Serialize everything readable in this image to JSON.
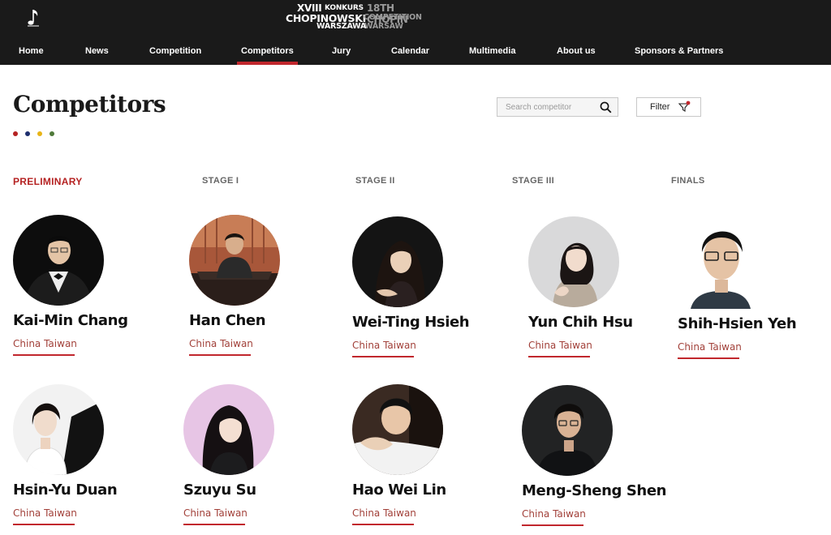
{
  "brand": {
    "line1_roman": "XVIII",
    "line1_konkurs": "KONKURS",
    "line1_ordinal": "18TH CHOPIN",
    "line2_name": "CHOPINOWSKI",
    "line2_competition": "COMPETITION",
    "line3_city": "WARSZAWA",
    "line3_city_en": "WARSAW",
    "icon": "piano-note-icon"
  },
  "nav": {
    "items": [
      {
        "label": "Home"
      },
      {
        "label": "News"
      },
      {
        "label": "Competition"
      },
      {
        "label": "Competitors"
      },
      {
        "label": "Jury"
      },
      {
        "label": "Calendar"
      },
      {
        "label": "Multimedia"
      },
      {
        "label": "About us"
      },
      {
        "label": "Sponsors & Partners"
      }
    ],
    "active": "Competitors"
  },
  "page": {
    "title": "Competitors",
    "dot_colors": [
      "#b52222",
      "#1e2f6e",
      "#e8b417",
      "#4f7a3a"
    ]
  },
  "search": {
    "placeholder": "Search competitor",
    "icon": "search-icon"
  },
  "filter": {
    "label": "Filter",
    "icon": "filter-icon"
  },
  "stages": [
    {
      "label": "PRELIMINARY",
      "active": true
    },
    {
      "label": "STAGE I"
    },
    {
      "label": "STAGE II"
    },
    {
      "label": "STAGE III"
    },
    {
      "label": "FINALS"
    }
  ],
  "competitors": [
    {
      "name": "Kai-Min Chang",
      "country": "China Taiwan"
    },
    {
      "name": "Han Chen",
      "country": "China Taiwan"
    },
    {
      "name": "Wei-Ting Hsieh",
      "country": "China Taiwan"
    },
    {
      "name": "Yun Chih Hsu",
      "country": "China Taiwan"
    },
    {
      "name": "Shih-Hsien Yeh",
      "country": "China Taiwan"
    },
    {
      "name": "Hsin-Yu Duan",
      "country": "China Taiwan"
    },
    {
      "name": "Szuyu Su",
      "country": "China Taiwan"
    },
    {
      "name": "Hao Wei Lin",
      "country": "China Taiwan"
    },
    {
      "name": "Meng-Sheng Shen",
      "country": "China Taiwan"
    }
  ],
  "colors": {
    "accent": "#c1272d",
    "header_bg": "#1a1a1a"
  }
}
